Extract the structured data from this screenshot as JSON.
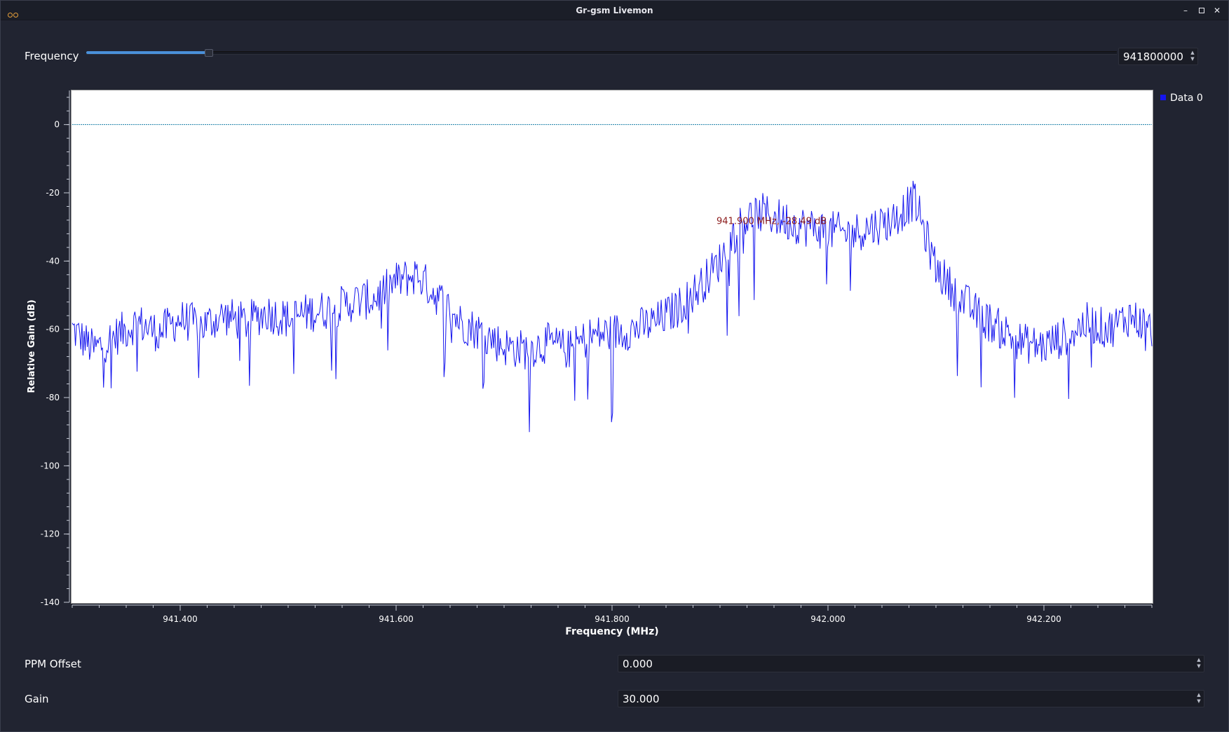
{
  "window": {
    "title": "Gr-gsm Livemon",
    "buttons": {
      "minimize": "–",
      "close": "✕"
    }
  },
  "frequency": {
    "label": "Frequency",
    "value": "941800000",
    "slider_fraction": 0.119
  },
  "ppm_offset": {
    "label": "PPM Offset",
    "value": "0.000"
  },
  "gain": {
    "label": "Gain",
    "value": "30.000"
  },
  "spin_arrows": {
    "up": "▲",
    "down": "▼"
  },
  "colors": {
    "background": "#212431",
    "accent": "#4a90d9",
    "trace": "#1515ee",
    "reference_line": "#1a7fa8",
    "marker_text": "#8b1a1a"
  },
  "chart_data": {
    "type": "line",
    "title": "",
    "xlabel": "Frequency (MHz)",
    "ylabel": "Relative Gain (dB)",
    "xlim": [
      941.3,
      942.3
    ],
    "ylim": [
      -140,
      10
    ],
    "x_ticks": [
      941.4,
      941.6,
      941.8,
      942.0,
      942.2
    ],
    "x_tick_labels": [
      "941.400",
      "941.600",
      "941.800",
      "942.000",
      "942.200"
    ],
    "y_ticks": [
      0,
      -20,
      -40,
      -60,
      -80,
      -100,
      -120,
      -140
    ],
    "y_tick_labels": [
      "0",
      "-20",
      "-40",
      "-60",
      "-80",
      "-100",
      "-120",
      "-140"
    ],
    "reference_line_y": 0,
    "legend_position": "top-right",
    "grid": false,
    "marker": {
      "x": 941.9,
      "y": -28.49,
      "label": "941.900 MHz, -28.49 dB"
    },
    "series": [
      {
        "name": "Data 0",
        "color": "#1515ee",
        "x": [
          941.3,
          941.32,
          941.34,
          941.36,
          941.38,
          941.4,
          941.42,
          941.44,
          941.46,
          941.48,
          941.5,
          941.52,
          941.54,
          941.56,
          941.58,
          941.6,
          941.62,
          941.64,
          941.66,
          941.68,
          941.7,
          941.72,
          941.74,
          941.76,
          941.78,
          941.8,
          941.82,
          941.84,
          941.86,
          941.88,
          941.9,
          941.92,
          941.94,
          941.96,
          941.98,
          942.0,
          942.02,
          942.04,
          942.06,
          942.08,
          942.1,
          942.12,
          942.14,
          942.16,
          942.18,
          942.2,
          942.22,
          942.24,
          942.26,
          942.28,
          942.3
        ],
        "y": [
          -60,
          -66,
          -62,
          -58,
          -61,
          -57,
          -59,
          -56,
          -58,
          -55,
          -57,
          -55,
          -54,
          -52,
          -51,
          -46,
          -44,
          -51,
          -58,
          -61,
          -65,
          -66,
          -64,
          -66,
          -62,
          -61,
          -60,
          -58,
          -54,
          -48,
          -40,
          -28,
          -26,
          -28,
          -30,
          -31,
          -32,
          -30,
          -28,
          -22,
          -42,
          -50,
          -56,
          -60,
          -64,
          -65,
          -62,
          -58,
          -60,
          -56,
          -60
        ],
        "noise_amplitude_db": 6,
        "point_count": 1000
      }
    ]
  }
}
